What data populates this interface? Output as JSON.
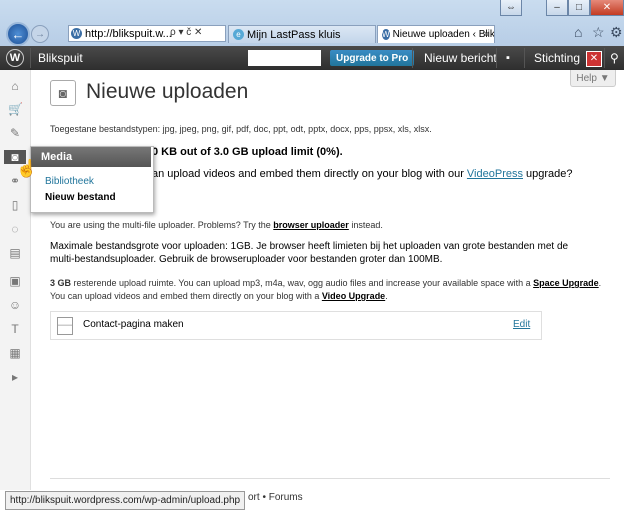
{
  "browser": {
    "address": "http://blikspuit.w...",
    "search_icons": "ρ ▾ č ✕",
    "tabs": [
      {
        "label": "Mijn LastPass kluis"
      },
      {
        "label": "Nieuwe uploaden ‹ Blikspui..."
      }
    ],
    "tab_close": "×",
    "status_url": "http://blikspuit.wordpress.com/wp-admin/upload.php"
  },
  "adminbar": {
    "site": "Blikspuit",
    "upgrade": "Upgrade to Pro",
    "new_post": "Nieuw bericht",
    "stichting": "Stichting"
  },
  "page": {
    "title": "Nieuwe uploaden",
    "help": "Help ▼",
    "allowed": "Toegestane bestandstypen: jpg, jpeg, png, gif, pdf, doc, ppt, odt, pptx, docx, pps, ppsx, xls, xlsx.",
    "usage": "0 KB out of 3.0 GB upload limit (0%).",
    "video_pre": "an upload videos and embed them directly on your blog with our ",
    "video_link": "VideoPress",
    "video_post": " upgrade?",
    "multi_pre": "You are using the multi-file uploader. Problems? Try the ",
    "multi_link": "browser uploader",
    "multi_post": " instead.",
    "max_size": "Maximale bestandsgrote voor uploaden: 1GB. Je browser heeft limieten bij het uploaden van grote bestanden met de multi-bestandsuploader. Gebruik de browseruploader voor bestanden groter dan 100MB.",
    "space_pre": "3 GB",
    "space_mid": " resterende upload ruimte. You can upload mp3, m4a, wav, ogg audio files and increase your available space with a ",
    "space_link": "Space Upgrade",
    "space_post": ". You can upload videos and embed them directly on your blog with a ",
    "video_upgrade_link": "Video Upgrade",
    "space_end": ".",
    "item_name": "Contact-pagina maken",
    "item_edit": "Edit",
    "footer": "ort • Forums"
  },
  "media_menu": {
    "header": "Media",
    "items": [
      "Bibliotheek",
      "Nieuw bestand"
    ]
  },
  "colors": {
    "link": "#21759b",
    "upgrade": "#21759b",
    "bar": "#333333"
  }
}
